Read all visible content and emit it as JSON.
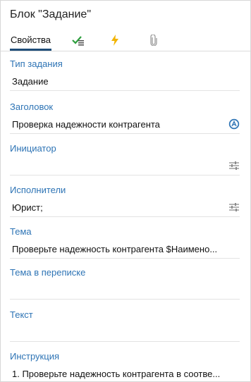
{
  "panel": {
    "title": "Блок \"Задание\""
  },
  "tabs": [
    {
      "label": "Свойства",
      "active": true
    },
    {
      "icon": "checklist-icon"
    },
    {
      "icon": "lightning-icon"
    },
    {
      "icon": "paperclip-icon"
    }
  ],
  "fields": [
    {
      "label": "Тип задания",
      "value": "Задание"
    },
    {
      "label": "Заголовок",
      "value": "Проверка надежности контрагента",
      "icon": "expression-icon"
    },
    {
      "label": "Инициатор",
      "value": "",
      "icon": "settings-sliders-icon"
    },
    {
      "label": "Исполнители",
      "value": "Юрист;",
      "icon": "settings-sliders-icon"
    },
    {
      "label": "Тема",
      "value": "Проверьте надежность контрагента $Наимено..."
    },
    {
      "label": "Тема в переписке",
      "value": ""
    },
    {
      "label": "Текст",
      "value": ""
    },
    {
      "label": "Инструкция",
      "value": "1. Проверьте надежность контрагента в соотве..."
    }
  ],
  "colors": {
    "label": "#2e74b5",
    "tab_underline": "#1f4e79",
    "check": "#2e9e3e",
    "lightning": "#f2b300"
  }
}
